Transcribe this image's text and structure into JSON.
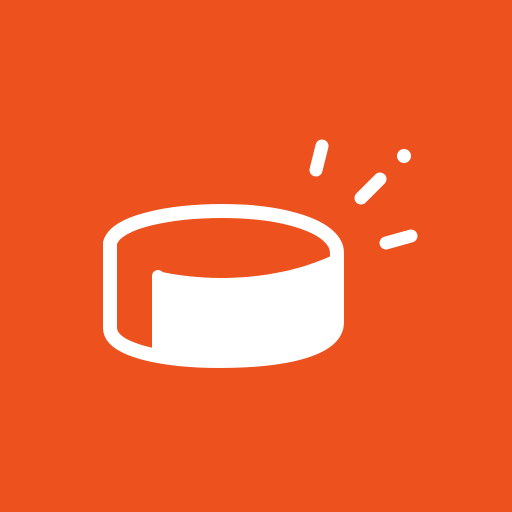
{
  "icon": {
    "name": "hockey-puck-icon",
    "background_color": "#EC511E",
    "foreground_color": "#FFFFFF"
  }
}
